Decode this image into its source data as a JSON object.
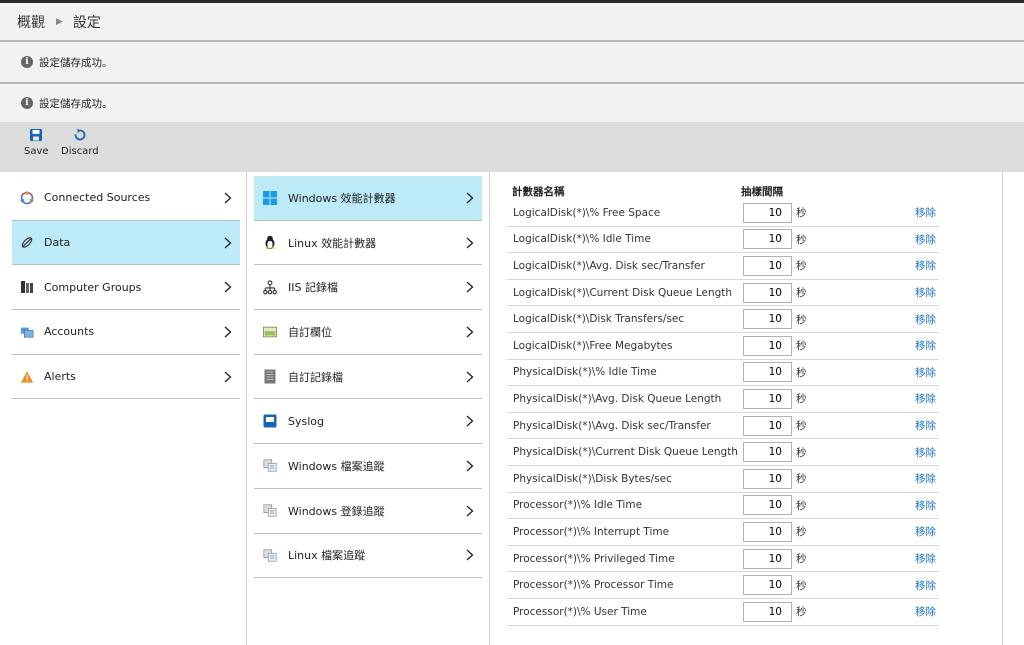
{
  "breadcrumb": {
    "items": [
      "概觀",
      "設定"
    ]
  },
  "notifications": [
    {
      "text": "設定儲存成功。"
    },
    {
      "text": "設定儲存成功。"
    }
  ],
  "toolbar": {
    "save_label": "Save",
    "discard_label": "Discard"
  },
  "sidebar": {
    "items": [
      {
        "label": "Connected Sources",
        "icon": "connected-sources-icon"
      },
      {
        "label": "Data",
        "icon": "data-icon",
        "selected": true
      },
      {
        "label": "Computer Groups",
        "icon": "computer-groups-icon"
      },
      {
        "label": "Accounts",
        "icon": "accounts-icon"
      },
      {
        "label": "Alerts",
        "icon": "alert-icon"
      }
    ]
  },
  "data_nav": {
    "items": [
      {
        "label": "Windows 效能計數器",
        "icon": "windows-icon",
        "selected": true
      },
      {
        "label": "Linux 效能計數器",
        "icon": "linux-icon"
      },
      {
        "label": "IIS 記錄檔",
        "icon": "iis-icon"
      },
      {
        "label": "自訂欄位",
        "icon": "custom-field-icon"
      },
      {
        "label": "自訂記錄檔",
        "icon": "custom-log-icon"
      },
      {
        "label": "Syslog",
        "icon": "syslog-icon"
      },
      {
        "label": "Windows 檔案追蹤",
        "icon": "file-tracking-icon"
      },
      {
        "label": "Windows 登錄追蹤",
        "icon": "registry-tracking-icon"
      },
      {
        "label": "Linux 檔案追蹤",
        "icon": "linux-file-tracking-icon"
      }
    ]
  },
  "counters": {
    "header_name": "計數器名稱",
    "header_interval": "抽樣間隔",
    "unit": "秒",
    "remove_label": "移除",
    "rows": [
      {
        "name": "LogicalDisk(*)\\% Free Space",
        "interval": "10"
      },
      {
        "name": "LogicalDisk(*)\\% Idle Time",
        "interval": "10"
      },
      {
        "name": "LogicalDisk(*)\\Avg. Disk sec/Transfer",
        "interval": "10"
      },
      {
        "name": "LogicalDisk(*)\\Current Disk Queue Length",
        "interval": "10"
      },
      {
        "name": "LogicalDisk(*)\\Disk Transfers/sec",
        "interval": "10"
      },
      {
        "name": "LogicalDisk(*)\\Free Megabytes",
        "interval": "10"
      },
      {
        "name": "PhysicalDisk(*)\\% Idle Time",
        "interval": "10"
      },
      {
        "name": "PhysicalDisk(*)\\Avg. Disk Queue Length",
        "interval": "10"
      },
      {
        "name": "PhysicalDisk(*)\\Avg. Disk sec/Transfer",
        "interval": "10"
      },
      {
        "name": "PhysicalDisk(*)\\Current Disk Queue Length",
        "interval": "10"
      },
      {
        "name": "PhysicalDisk(*)\\Disk Bytes/sec",
        "interval": "10"
      },
      {
        "name": "Processor(*)\\% Idle Time",
        "interval": "10"
      },
      {
        "name": "Processor(*)\\% Interrupt Time",
        "interval": "10"
      },
      {
        "name": "Processor(*)\\% Privileged Time",
        "interval": "10"
      },
      {
        "name": "Processor(*)\\% Processor Time",
        "interval": "10"
      },
      {
        "name": "Processor(*)\\% User Time",
        "interval": "10"
      }
    ]
  }
}
